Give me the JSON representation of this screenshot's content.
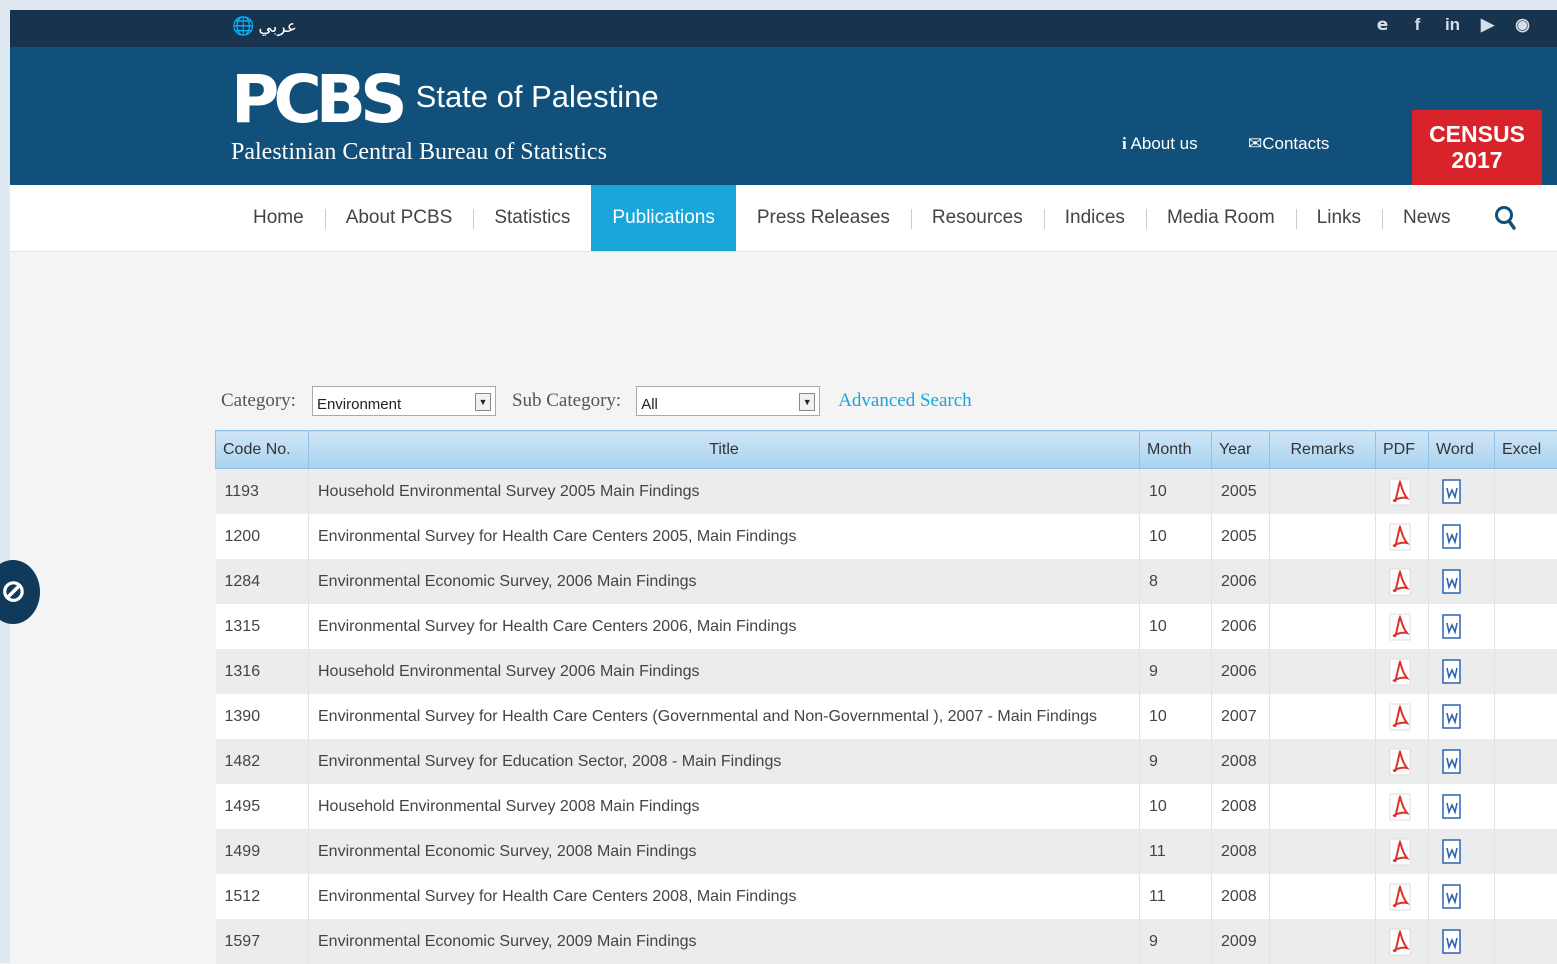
{
  "topbar": {
    "language_label": "عربي",
    "social_icons": [
      "twitter-icon",
      "facebook-icon",
      "linkedin-icon",
      "youtube-icon",
      "instagram-icon"
    ]
  },
  "header": {
    "logo_mark": "PCBS",
    "logo_title": "State of Palestine",
    "logo_subtitle": "Palestinian Central Bureau of Statistics",
    "about_label": "About us",
    "contacts_label": "Contacts",
    "census_line1": "CENSUS",
    "census_line2": "2017"
  },
  "nav": {
    "items": [
      {
        "label": "Home"
      },
      {
        "label": "About PCBS"
      },
      {
        "label": "Statistics"
      },
      {
        "label": "Publications",
        "active": true
      },
      {
        "label": "Press Releases"
      },
      {
        "label": "Resources"
      },
      {
        "label": "Indices"
      },
      {
        "label": "Media Room"
      },
      {
        "label": "Links"
      },
      {
        "label": "News"
      }
    ]
  },
  "filters": {
    "category_label": "Category:",
    "category_value": "Environment",
    "subcategory_label": "Sub Category:",
    "subcategory_value": "All",
    "advanced_search": "Advanced Search"
  },
  "table": {
    "headers": [
      "Code No.",
      "Title",
      "Month",
      "Year",
      "Remarks",
      "PDF",
      "Word",
      "Excel"
    ],
    "rows": [
      {
        "code": "1193",
        "title": "Household Environmental Survey 2005 Main Findings",
        "month": "10",
        "year": "2005"
      },
      {
        "code": "1200",
        "title": "Environmental Survey for Health Care Centers 2005, Main Findings",
        "month": "10",
        "year": "2005"
      },
      {
        "code": "1284",
        "title": "Environmental Economic Survey, 2006 Main Findings",
        "month": "8",
        "year": "2006"
      },
      {
        "code": "1315",
        "title": "Environmental Survey for Health Care Centers 2006, Main Findings",
        "month": "10",
        "year": "2006"
      },
      {
        "code": "1316",
        "title": "Household Environmental Survey 2006 Main Findings",
        "month": "9",
        "year": "2006"
      },
      {
        "code": "1390",
        "title": "Environmental Survey for Health Care Centers (Governmental and Non-Governmental ), 2007 - Main Findings",
        "month": "10",
        "year": "2007"
      },
      {
        "code": "1482",
        "title": "Environmental Survey for Education Sector, 2008 - Main Findings",
        "month": "9",
        "year": "2008"
      },
      {
        "code": "1495",
        "title": "Household Environmental Survey 2008 Main Findings",
        "month": "10",
        "year": "2008"
      },
      {
        "code": "1499",
        "title": "Environmental Economic Survey, 2008 Main Findings",
        "month": "11",
        "year": "2008"
      },
      {
        "code": "1512",
        "title": "Environmental Survey for Health Care Centers 2008, Main Findings",
        "month": "11",
        "year": "2008"
      },
      {
        "code": "1597",
        "title": "Environmental Economic Survey, 2009 Main Findings",
        "month": "9",
        "year": "2009"
      }
    ]
  }
}
